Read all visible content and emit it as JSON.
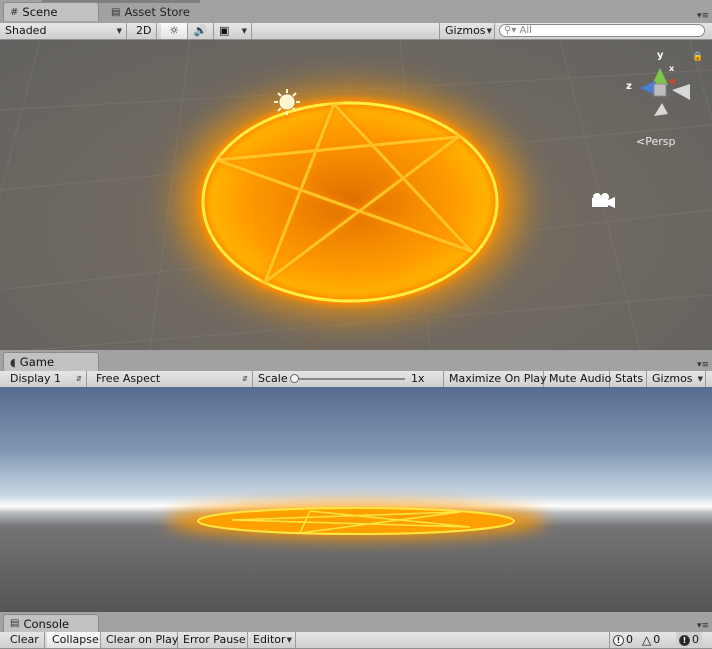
{
  "scene_tabs": {
    "scene": {
      "label": "Scene",
      "icon": "grid-icon"
    },
    "asset_store": {
      "label": "Asset Store",
      "icon": "shopping-bag-icon"
    }
  },
  "scene_toolbar": {
    "shading_mode": "Shaded",
    "mode_2d": "2D",
    "lighting_icon": "sun-icon",
    "audio_icon": "speaker-icon",
    "effects_icon": "image-icon",
    "gizmos_label": "Gizmos",
    "search_placeholder": "All"
  },
  "scene_gizmo": {
    "y_label": "y",
    "z_label": "z",
    "x_label": "x",
    "projection_label": "Persp"
  },
  "game_tab": {
    "label": "Game",
    "icon": "pacman-icon"
  },
  "game_toolbar": {
    "display": "Display 1",
    "aspect": "Free Aspect",
    "scale_label": "Scale",
    "scale_value": "1x",
    "scale_slider": 0.0,
    "maximize_on_play": "Maximize On Play",
    "mute_audio": "Mute Audio",
    "stats": "Stats",
    "gizmos": "Gizmos"
  },
  "console_tab": {
    "label": "Console",
    "icon": "console-icon"
  },
  "console_toolbar": {
    "clear": "Clear",
    "collapse": "Collapse",
    "clear_on_play": "Clear on Play",
    "error_pause": "Error Pause",
    "editor": "Editor",
    "info_count": "0",
    "warning_count": "0",
    "error_count": "0"
  },
  "colors": {
    "magic_circle": "#ffe600",
    "magic_glow": "#ff9d00",
    "sky_top": "#566d8f",
    "ground": "#555555"
  }
}
